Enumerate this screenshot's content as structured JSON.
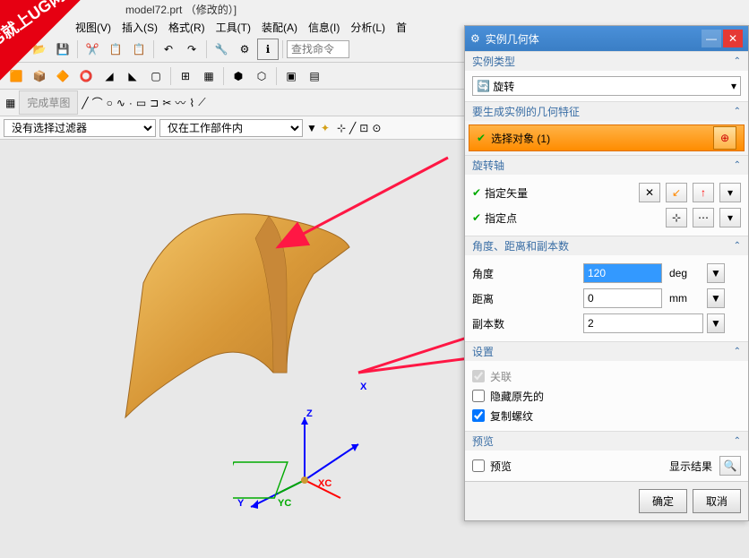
{
  "title": "model72.prt （修改的）]",
  "menu": [
    "视图(V)",
    "插入(S)",
    "格式(R)",
    "工具(T)",
    "装配(A)",
    "信息(I)",
    "分析(L)",
    "首"
  ],
  "search_placeholder": "查找命令",
  "sketch_btn": "完成草图",
  "filter": {
    "no_filter": "没有选择过滤器",
    "scope": "仅在工作部件内"
  },
  "dialog": {
    "title": "实例几何体",
    "section_type": "实例类型",
    "type_value": "旋转",
    "section_geom": "要生成实例的几何特征",
    "select_obj": "选择对象 (1)",
    "section_axis": "旋转轴",
    "specify_vector": "指定矢量",
    "specify_point": "指定点",
    "section_params": "角度、距离和副本数",
    "angle_label": "角度",
    "angle_value": "120",
    "angle_unit": "deg",
    "distance_label": "距离",
    "distance_value": "0",
    "distance_unit": "mm",
    "copies_label": "副本数",
    "copies_value": "2",
    "section_settings": "设置",
    "assoc": "关联",
    "hide_orig": "隐藏原先的",
    "copy_thread": "复制螺纹",
    "section_preview": "预览",
    "preview_chk": "预览",
    "show_result": "显示结果",
    "ok": "确定",
    "cancel": "取消"
  },
  "axes": {
    "x": "X",
    "y": "Y",
    "z": "Z",
    "xc": "XC",
    "yc": "YC"
  }
}
